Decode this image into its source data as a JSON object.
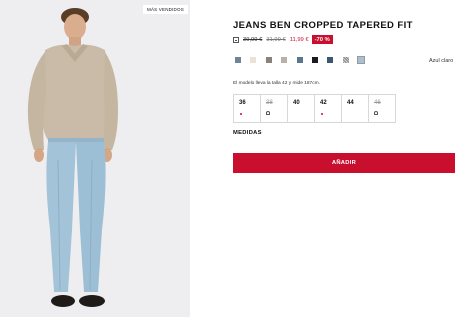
{
  "product": {
    "badge": "MÁS VENDIDOS",
    "title": "JEANS BEN CROPPED TAPERED FIT",
    "price_icon": "tag-icon",
    "price_old": "39,99 €",
    "price_mid": "31,99 €",
    "price_now": "11,99 €",
    "discount": "-70 %",
    "swatches": [
      {
        "color": "#6f8597"
      },
      {
        "color": "#ebe2d6"
      },
      {
        "color": "#8d8077"
      },
      {
        "color": "#b7b0ab"
      },
      {
        "color": "#5b7690"
      },
      {
        "color": "#181b1f"
      },
      {
        "color": "#3e5770"
      },
      {
        "color": "#8a8d90",
        "pattern": "striped"
      },
      {
        "color": "#a8c0d4",
        "selected": true
      }
    ],
    "color_name": "Azul claro",
    "model_info": "El modelo lleva la talla 42 y mide 187cm.",
    "sizes": [
      {
        "label": "36",
        "available": true,
        "indicator": "dot"
      },
      {
        "label": "38",
        "available": false,
        "indicator": "bell"
      },
      {
        "label": "40",
        "available": true,
        "indicator": "none"
      },
      {
        "label": "42",
        "available": true,
        "indicator": "dot"
      },
      {
        "label": "44",
        "available": true,
        "indicator": "none"
      },
      {
        "label": "46",
        "available": false,
        "indicator": "bell"
      }
    ],
    "measures_label": "MEDIDAS",
    "add_label": "AÑADIR"
  },
  "colors": {
    "accent": "#c8102e",
    "photo_bg": "#eeeef0"
  }
}
